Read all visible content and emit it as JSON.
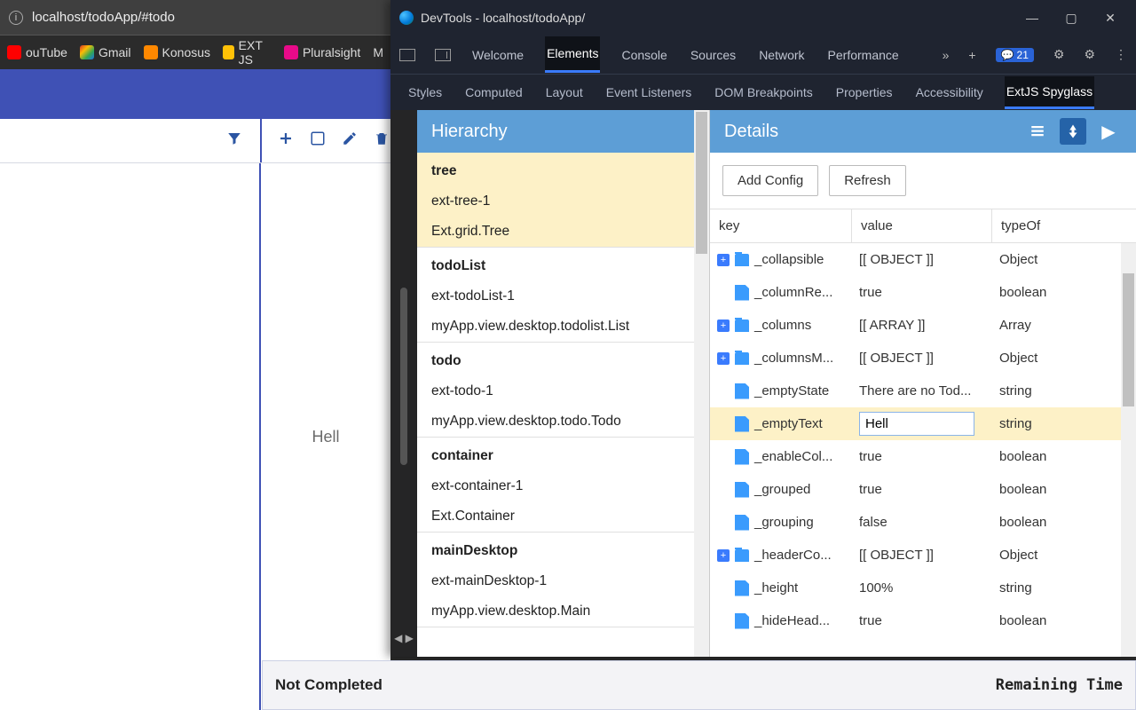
{
  "browser": {
    "url": "localhost/todoApp/#todo",
    "bookmarks": [
      {
        "label": "ouTube"
      },
      {
        "label": "Gmail"
      },
      {
        "label": "Konosus"
      },
      {
        "label": "EXT JS"
      },
      {
        "label": "Pluralsight"
      },
      {
        "label": "M"
      }
    ]
  },
  "app": {
    "empty_text": "Hell",
    "footer_left": "Not Completed",
    "footer_right": "Remaining Time"
  },
  "devtools": {
    "title": "DevTools - localhost/todoApp/",
    "main_tabs": [
      "Welcome",
      "Elements",
      "Console",
      "Sources",
      "Network",
      "Performance"
    ],
    "main_active": "Elements",
    "badge_count": "21",
    "sub_tabs": [
      "Styles",
      "Computed",
      "Layout",
      "Event Listeners",
      "DOM Breakpoints",
      "Properties",
      "Accessibility",
      "ExtJS Spyglass"
    ],
    "sub_active": "ExtJS Spyglass",
    "hierarchy_title": "Hierarchy",
    "hierarchy_groups": [
      {
        "selected": true,
        "rows": [
          "tree",
          "ext-tree-1",
          "Ext.grid.Tree"
        ]
      },
      {
        "selected": false,
        "rows": [
          "todoList",
          "ext-todoList-1",
          "myApp.view.desktop.todolist.List"
        ]
      },
      {
        "selected": false,
        "rows": [
          "todo",
          "ext-todo-1",
          "myApp.view.desktop.todo.Todo"
        ]
      },
      {
        "selected": false,
        "rows": [
          "container",
          "ext-container-1",
          "Ext.Container"
        ]
      },
      {
        "selected": false,
        "rows": [
          "mainDesktop",
          "ext-mainDesktop-1",
          "myApp.view.desktop.Main"
        ]
      }
    ],
    "details_title": "Details",
    "btn_add": "Add Config",
    "btn_refresh": "Refresh",
    "grid_headers": {
      "key": "key",
      "value": "value",
      "typeOf": "typeOf"
    },
    "rows": [
      {
        "exp": true,
        "folder": true,
        "key": "_collapsible",
        "value": "[[ OBJECT ]]",
        "type": "Object"
      },
      {
        "exp": false,
        "folder": false,
        "key": "_columnRe...",
        "value": "true",
        "type": "boolean"
      },
      {
        "exp": true,
        "folder": true,
        "key": "_columns",
        "value": "[[ ARRAY ]]",
        "type": "Array"
      },
      {
        "exp": true,
        "folder": true,
        "key": "_columnsM...",
        "value": "[[ OBJECT ]]",
        "type": "Object"
      },
      {
        "exp": false,
        "folder": false,
        "key": "_emptyState",
        "value": "There are no Tod...",
        "type": "string"
      },
      {
        "exp": false,
        "folder": false,
        "key": "_emptyText",
        "value": "Hell",
        "type": "string",
        "editing": true,
        "selected": true
      },
      {
        "exp": false,
        "folder": false,
        "key": "_enableCol...",
        "value": "true",
        "type": "boolean"
      },
      {
        "exp": false,
        "folder": false,
        "key": "_grouped",
        "value": "true",
        "type": "boolean"
      },
      {
        "exp": false,
        "folder": false,
        "key": "_grouping",
        "value": "false",
        "type": "boolean"
      },
      {
        "exp": true,
        "folder": true,
        "key": "_headerCo...",
        "value": "[[ OBJECT ]]",
        "type": "Object"
      },
      {
        "exp": false,
        "folder": false,
        "key": "_height",
        "value": "100%",
        "type": "string"
      },
      {
        "exp": false,
        "folder": false,
        "key": "_hideHead...",
        "value": "true",
        "type": "boolean"
      }
    ]
  }
}
